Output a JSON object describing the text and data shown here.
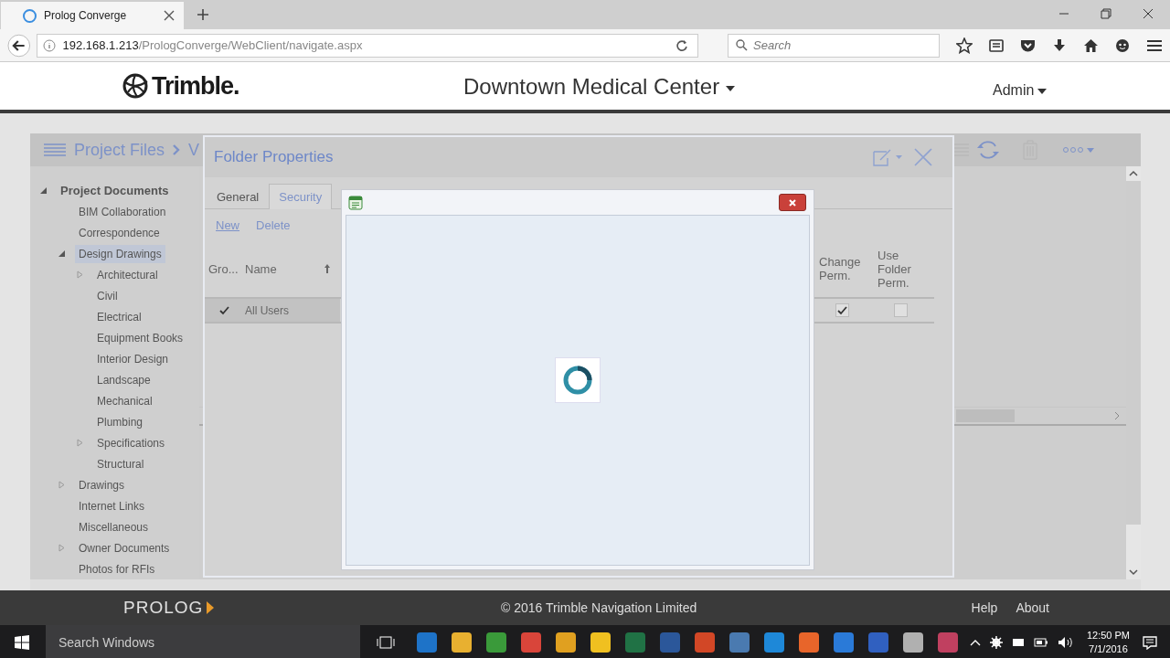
{
  "browser": {
    "tab": {
      "title": "Prolog Converge"
    },
    "url": {
      "host": "192.168.1.213",
      "path": "/PrologConverge/WebClient/navigate.aspx"
    },
    "search": {
      "placeholder": "Search"
    }
  },
  "header": {
    "logo": "Trimble.",
    "project": "Downtown Medical Center",
    "user": "Admin"
  },
  "breadcrumb": [
    "Project Files",
    "V"
  ],
  "tree": [
    {
      "label": "Project Documents",
      "expanded": true,
      "selected": false,
      "children": [
        {
          "label": "BIM Collaboration",
          "selected": false
        },
        {
          "label": "Correspondence",
          "selected": false
        },
        {
          "label": "Design Drawings",
          "expanded": true,
          "selected": true,
          "children": [
            {
              "label": "Architectural",
              "expanded": false,
              "selected": false
            },
            {
              "label": "Civil",
              "selected": false
            },
            {
              "label": "Electrical",
              "selected": false
            },
            {
              "label": "Equipment Books",
              "selected": false
            },
            {
              "label": "Interior Design",
              "selected": false
            },
            {
              "label": "Landscape",
              "selected": false
            },
            {
              "label": "Mechanical",
              "selected": false
            },
            {
              "label": "Plumbing",
              "selected": false
            },
            {
              "label": "Specifications",
              "expanded": false,
              "selected": false
            },
            {
              "label": "Structural",
              "selected": false
            }
          ]
        },
        {
          "label": "Drawings",
          "expanded": false,
          "selected": false
        },
        {
          "label": "Internet Links",
          "selected": false
        },
        {
          "label": "Miscellaneous",
          "selected": false
        },
        {
          "label": "Owner Documents",
          "expanded": false,
          "selected": false
        },
        {
          "label": "Photos for RFIs",
          "selected": false
        }
      ]
    }
  ],
  "dialog": {
    "title": "Folder Properties",
    "tabs": [
      {
        "label": "General",
        "selected": false
      },
      {
        "label": "Security",
        "selected": true
      }
    ],
    "actions": [
      "New",
      "Delete"
    ],
    "columns": [
      "Gro...",
      "Name",
      "Change Perm.",
      "Use Folder Perm."
    ],
    "rows": [
      {
        "group": true,
        "name": "All Users",
        "selected": true,
        "change_perm": true,
        "use_folder_perm": false
      }
    ]
  },
  "footer": {
    "brand": "PROLOG",
    "copyright": "© 2016 Trimble Navigation Limited",
    "links": [
      "Help",
      "About"
    ]
  },
  "taskbar": {
    "search": {
      "placeholder": "Search Windows"
    },
    "time": "12:50 PM",
    "date": "7/1/2016"
  }
}
